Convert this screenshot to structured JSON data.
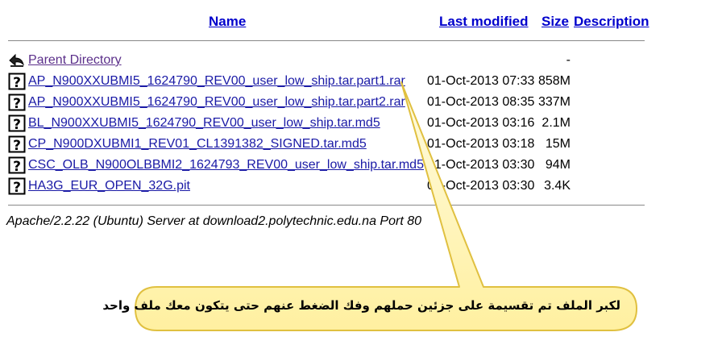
{
  "headers": {
    "name": "Name",
    "last_modified": "Last modified",
    "size": "Size",
    "description": "Description"
  },
  "parent": {
    "label": "Parent Directory",
    "size": "-",
    "icon": "back-arrow-icon"
  },
  "files": [
    {
      "name": "AP_N900XXUBMI5_1624790_REV00_user_low_ship.tar.part1.rar",
      "date": "01-Oct-2013 07:33",
      "size": "858M",
      "icon": "unknown-file-icon"
    },
    {
      "name": "AP_N900XXUBMI5_1624790_REV00_user_low_ship.tar.part2.rar",
      "date": "01-Oct-2013 08:35",
      "size": "337M",
      "icon": "unknown-file-icon"
    },
    {
      "name": "BL_N900XXUBMI5_1624790_REV00_user_low_ship.tar.md5",
      "date": "01-Oct-2013 03:16",
      "size": "2.1M",
      "icon": "unknown-file-icon"
    },
    {
      "name": "CP_N900DXUBMI1_REV01_CL1391382_SIGNED.tar.md5",
      "date": "01-Oct-2013 03:18",
      "size": "15M",
      "icon": "unknown-file-icon"
    },
    {
      "name": "CSC_OLB_N900OLBBMI2_1624793_REV00_user_low_ship.tar.md5",
      "date": "01-Oct-2013 03:30",
      "size": "94M",
      "icon": "unknown-file-icon"
    },
    {
      "name": "HA3G_EUR_OPEN_32G.pit",
      "date": "01-Oct-2013 03:30",
      "size": "3.4K",
      "icon": "unknown-file-icon"
    }
  ],
  "server_signature": "Apache/2.2.22 (Ubuntu) Server at download2.polytechnic.edu.na Port 80",
  "callout": {
    "text": "لكبر الملف تم تقسيمة على جزئين حملهم وفك الضغط عنهم حتى يتكون معك ملف واحد",
    "fill": "#fff7b0",
    "stroke": "#e6c84a"
  },
  "colors": {
    "link": "#0000cc",
    "visited": "#5b2f8a"
  }
}
